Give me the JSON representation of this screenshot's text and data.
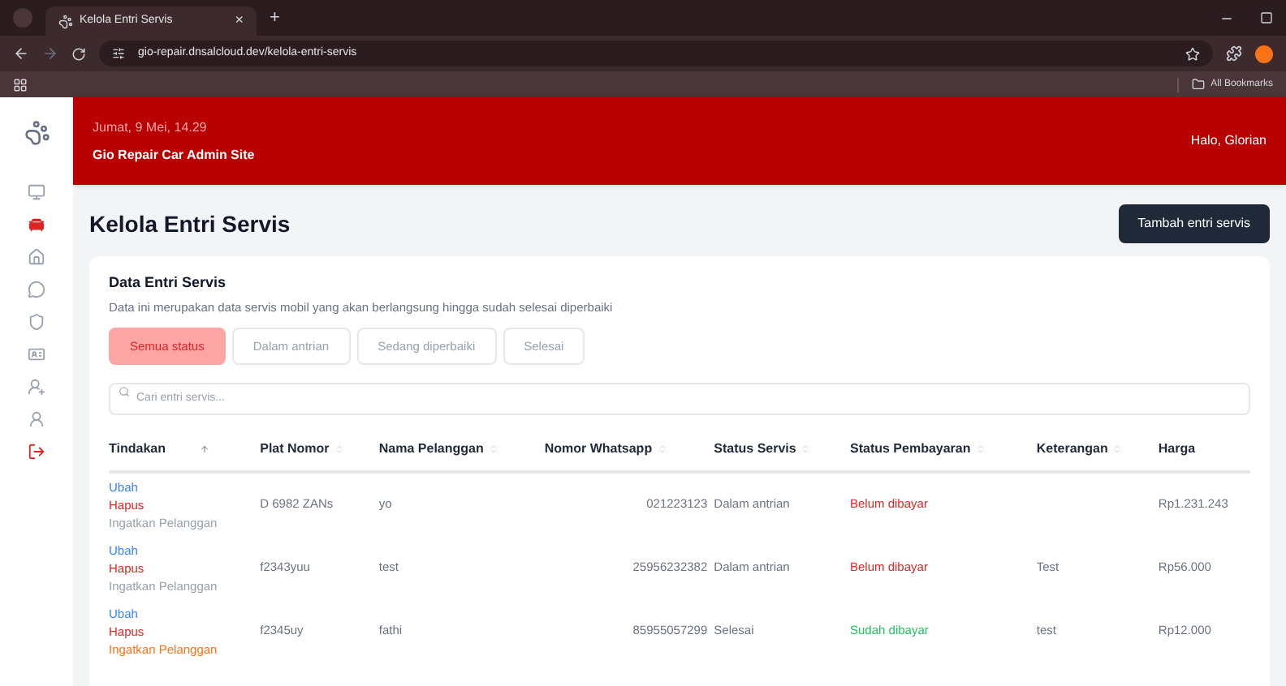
{
  "browser": {
    "tab_title": "Kelola Entri Servis",
    "tab_close": "×",
    "new_tab": "+",
    "url": "gio-repair.dnsalcloud.dev/kelola-entri-servis",
    "bookmarks": "All Bookmarks"
  },
  "sidebar": {
    "items": [
      {
        "kind": "monitor",
        "selected": false
      },
      {
        "kind": "car",
        "selected": true
      },
      {
        "kind": "home",
        "selected": false
      },
      {
        "kind": "chat",
        "selected": false
      },
      {
        "kind": "shield",
        "selected": false
      },
      {
        "kind": "card",
        "selected": false
      },
      {
        "kind": "user-add",
        "selected": false
      },
      {
        "kind": "user",
        "selected": false
      },
      {
        "kind": "logout",
        "selected": false
      }
    ]
  },
  "header": {
    "date": "Jumat, 9 Mei, 14.29",
    "site": "Gio Repair Car Admin Site",
    "greeting": "Halo, Glorian"
  },
  "page": {
    "title": "Kelola Entri Servis",
    "add_button": "Tambah entri servis"
  },
  "card": {
    "title": "Data Entri Servis",
    "description": "Data ini merupakan data servis mobil yang akan berlangsung hingga sudah selesai diperbaiki",
    "filters": [
      {
        "label": "Semua status",
        "selected": true
      },
      {
        "label": "Dalam antrian",
        "selected": false
      },
      {
        "label": "Sedang diperbaiki",
        "selected": false
      },
      {
        "label": "Selesai",
        "selected": false
      }
    ],
    "search": {
      "placeholder": "Cari entri servis..."
    }
  },
  "table": {
    "columns": [
      "Tindakan",
      "Plat Nomor",
      "Nama Pelanggan",
      "Nomor Whatsapp",
      "Status Servis",
      "Status Pembayaran",
      "Keterangan",
      "Harga"
    ],
    "rows": [
      {
        "edit": "Ubah",
        "delete": "Hapus",
        "remind": "Ingatkan Pelanggan",
        "remind_highlighted": false,
        "plate": "D 6982 ZANs",
        "name": "yo",
        "phone": "021223123",
        "service_status": "Dalam antrian",
        "payment": {
          "label": "Belum dibayar",
          "kind": "unpaid"
        },
        "price": "Rp1.231.243"
      },
      {
        "edit": "Ubah",
        "delete": "Hapus",
        "remind": "Ingatkan Pelanggan",
        "remind_highlighted": false,
        "plate": "f2343yuu",
        "name": "test",
        "phone": "25956232382",
        "service_status": "Dalam antrian",
        "payment": {
          "label": "Belum dibayar",
          "kind": "unpaid"
        },
        "note": "Test",
        "price": "Rp56.000"
      },
      {
        "edit": "Ubah",
        "delete": "Hapus",
        "remind": "Ingatkan Pelanggan",
        "remind_highlighted": true,
        "plate": "f2345uy",
        "name": "fathi",
        "phone": "85955057299",
        "service_status": "Selesai",
        "payment": {
          "label": "Sudah dibayar",
          "kind": "paid"
        },
        "note": "test",
        "price": "Rp12.000"
      }
    ]
  }
}
